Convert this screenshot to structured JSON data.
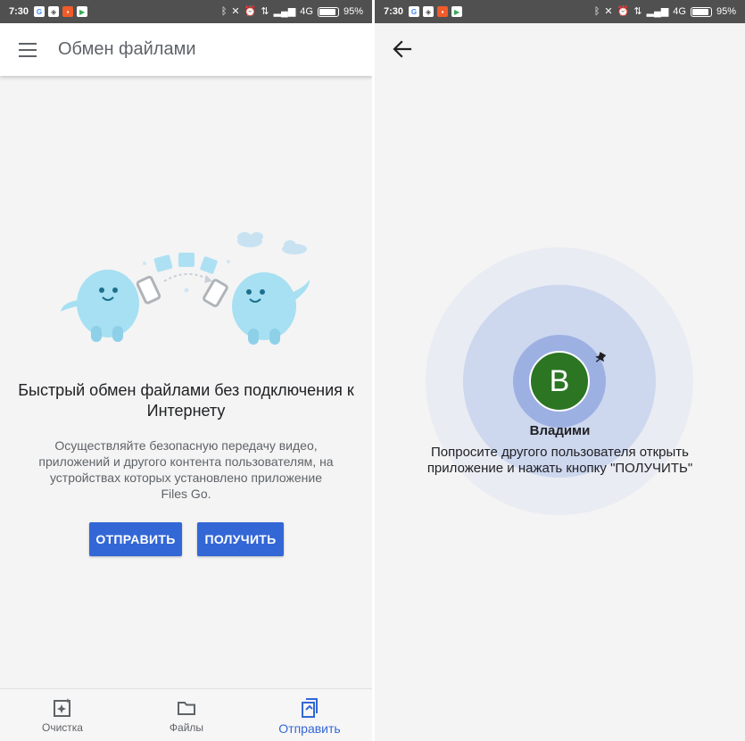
{
  "status_bar": {
    "time": "7:30",
    "network": "4G",
    "battery_percent": "95%",
    "battery_level": 0.95,
    "app_icons": [
      {
        "name": "google-icon",
        "letter": "G",
        "color": "#4285f4"
      },
      {
        "name": "shield-icon",
        "letter": "◈",
        "color": "#4a4a4a"
      },
      {
        "name": "app-icon",
        "letter": "▪",
        "color": "#ef5b2a"
      },
      {
        "name": "play-store-icon",
        "letter": "▶",
        "color": "#34a853"
      }
    ]
  },
  "left": {
    "app_title": "Обмен файлами",
    "headline": "Быстрый обмен файлами без подключения к Интернету",
    "description": "Осуществляйте безопасную передачу видео, приложений и другого контента пользователям, на устройствах которых установлено приложение Files Go.",
    "send_button": "ОТПРАВИТЬ",
    "receive_button": "ПОЛУЧИТЬ",
    "bottom_nav": [
      {
        "label": "Очистка",
        "icon": "cleanup-icon",
        "active": false
      },
      {
        "label": "Файлы",
        "icon": "folder-icon",
        "active": false
      },
      {
        "label": "Отправить",
        "icon": "share-files-icon",
        "active": true
      }
    ]
  },
  "right": {
    "avatar_letter": "В",
    "device_name": "Владими",
    "instructions": "Попросите другого пользователя открыть приложение и нажать кнопку \"ПОЛУЧИТЬ\""
  },
  "colors": {
    "accent": "#3367d6",
    "avatar": "#2c7523",
    "background": "#f4f4f4",
    "status_bar": "#505050"
  }
}
